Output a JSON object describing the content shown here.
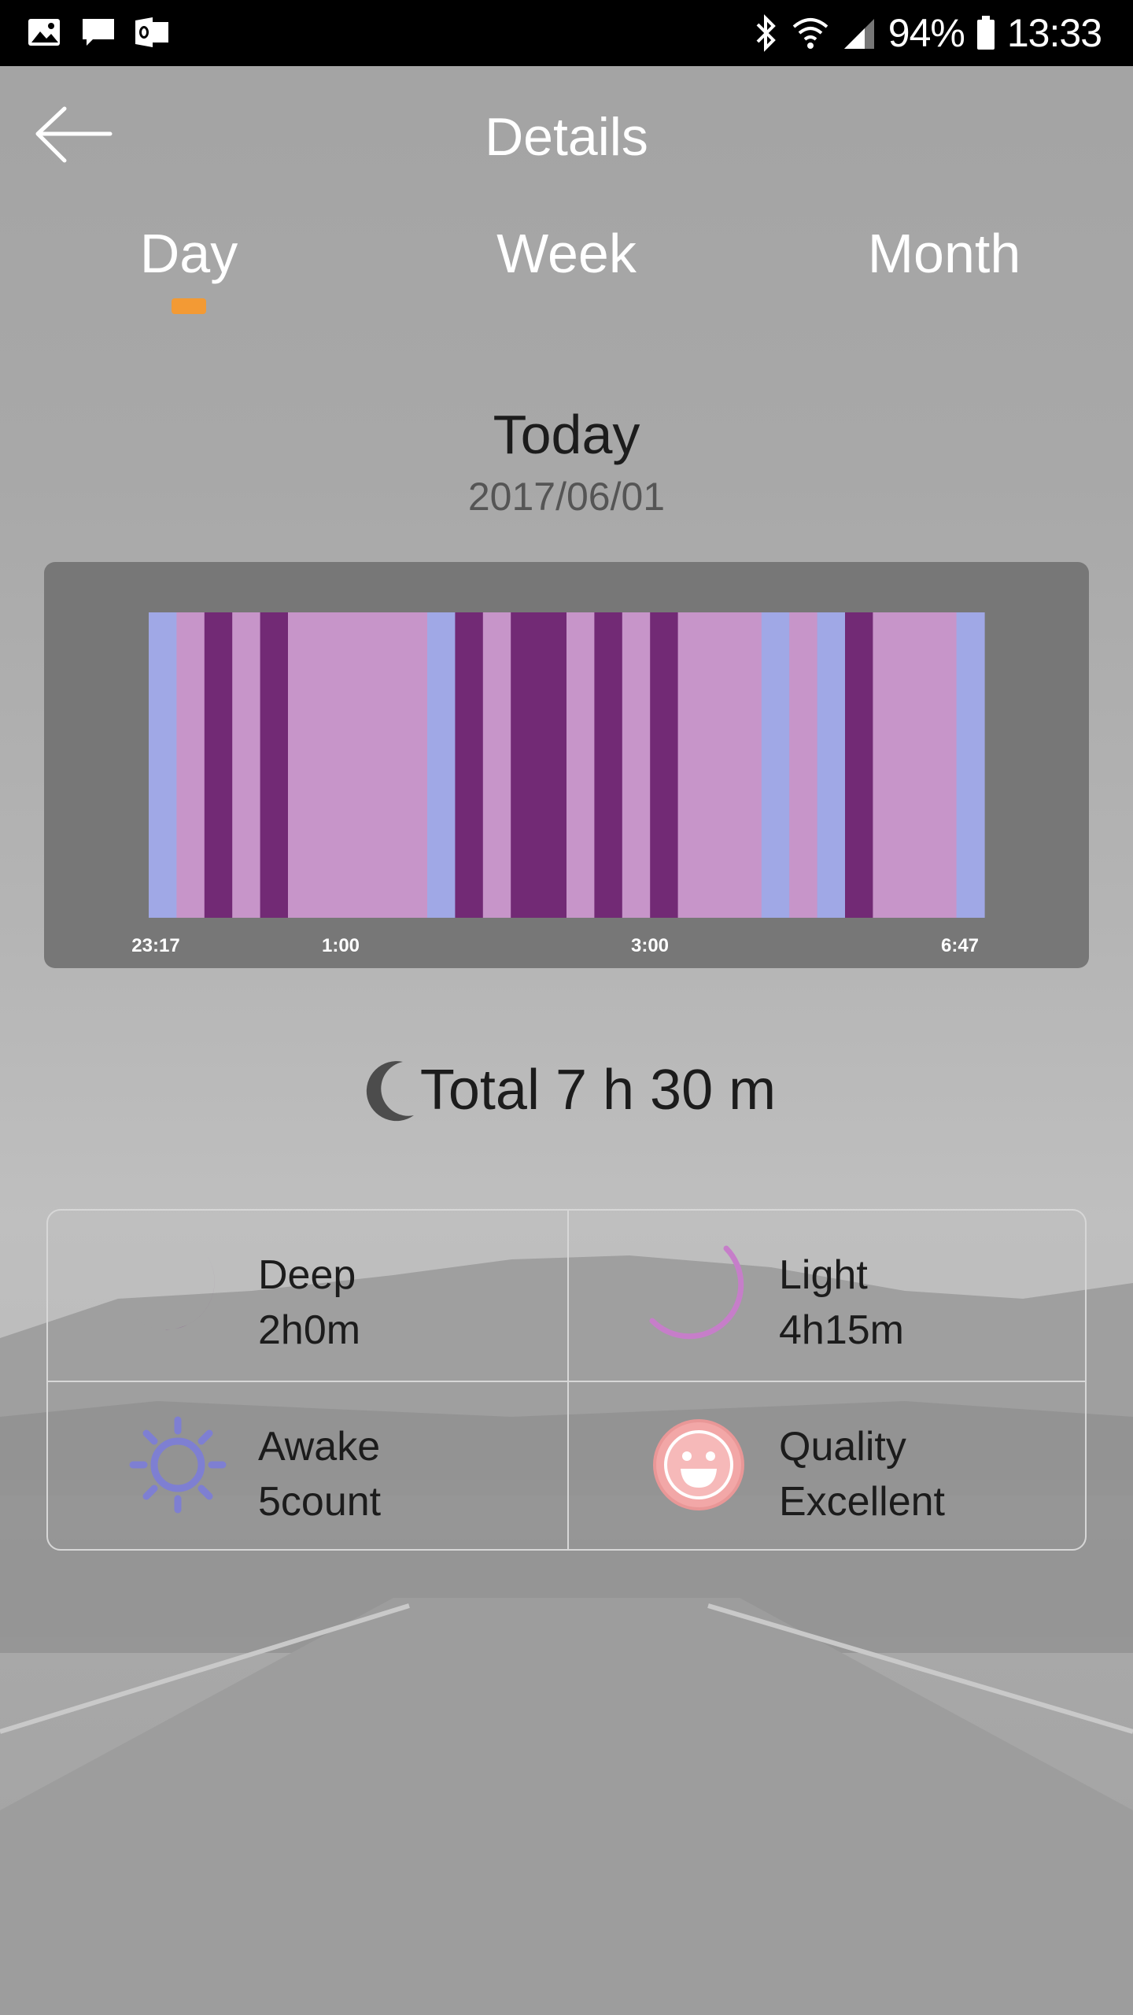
{
  "status_bar": {
    "battery": "94%",
    "time": "13:33"
  },
  "header": {
    "title": "Details"
  },
  "tabs": [
    {
      "label": "Day",
      "active": true
    },
    {
      "label": "Week",
      "active": false
    },
    {
      "label": "Month",
      "active": false
    }
  ],
  "date_block": {
    "heading": "Today",
    "date": "2017/06/01"
  },
  "colors": {
    "awake": "#a0a8e6",
    "light": "#c795c9",
    "deep": "#722a75",
    "accent": "#f39a34"
  },
  "chart_data": {
    "type": "bar",
    "x_ticks": [
      "23:17",
      "1:00",
      "3:00",
      "6:47"
    ],
    "segments": [
      {
        "stage": "awake",
        "units": 1
      },
      {
        "stage": "light",
        "units": 1
      },
      {
        "stage": "deep",
        "units": 1
      },
      {
        "stage": "light",
        "units": 1
      },
      {
        "stage": "deep",
        "units": 1
      },
      {
        "stage": "light",
        "units": 5
      },
      {
        "stage": "awake",
        "units": 1
      },
      {
        "stage": "deep",
        "units": 1
      },
      {
        "stage": "light",
        "units": 1
      },
      {
        "stage": "deep",
        "units": 2
      },
      {
        "stage": "light",
        "units": 1
      },
      {
        "stage": "deep",
        "units": 1
      },
      {
        "stage": "light",
        "units": 1
      },
      {
        "stage": "deep",
        "units": 1
      },
      {
        "stage": "light",
        "units": 3
      },
      {
        "stage": "awake",
        "units": 1
      },
      {
        "stage": "light",
        "units": 1
      },
      {
        "stage": "awake",
        "units": 1
      },
      {
        "stage": "deep",
        "units": 1
      },
      {
        "stage": "light",
        "units": 3
      },
      {
        "stage": "awake",
        "units": 1
      }
    ]
  },
  "summary": {
    "total": "Total 7 h 30 m"
  },
  "stats": {
    "deep": {
      "label": "Deep",
      "value": "2h0m",
      "icon": "crescent-moon-icon"
    },
    "light": {
      "label": "Light",
      "value": "4h15m",
      "icon": "outline-moon-icon"
    },
    "awake": {
      "label": "Awake",
      "value": "5count",
      "icon": "sun-icon"
    },
    "quality": {
      "label": "Quality",
      "value": "Excellent",
      "icon": "smiley-icon"
    }
  }
}
